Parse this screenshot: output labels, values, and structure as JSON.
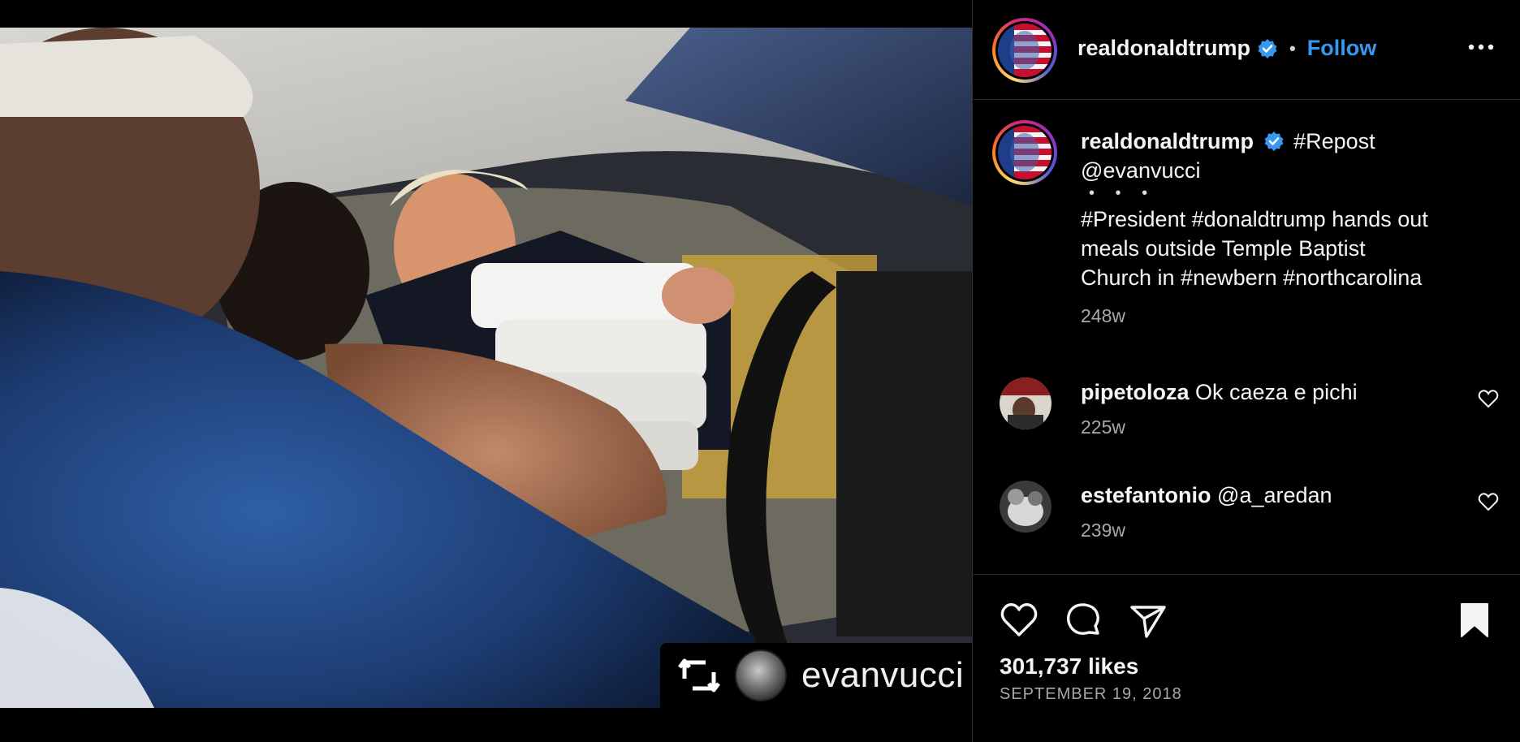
{
  "post": {
    "repost_credit": {
      "username": "evanvucci",
      "icon": "repost-icon"
    },
    "header": {
      "username": "realdonaldtrump",
      "separator": "•",
      "follow_label": "Follow",
      "verified_icon": "verified-badge-icon",
      "more_icon": "more-options-icon"
    },
    "caption": {
      "username": "realdonaldtrump",
      "line1_rest": "#Repost",
      "line2": "@evanvucci",
      "dots": "• • •",
      "line3": "#President #donaldtrump hands out",
      "line4": "meals outside Temple Baptist",
      "line5": "Church in #newbern #northcarolina",
      "time": "248w"
    },
    "comments": [
      {
        "username": "pipetoloza",
        "text": "Ok caeza e pichi",
        "time": "225w"
      },
      {
        "username": "estefantonio",
        "text": "@a_aredan",
        "time": "239w"
      }
    ],
    "actions": {
      "like_icon": "heart-icon",
      "comment_icon": "comment-icon",
      "share_icon": "send-icon",
      "save_icon": "bookmark-icon",
      "likes": "301,737 likes",
      "date": "SEPTEMBER 19, 2018"
    },
    "colors": {
      "accent": "#3897f0",
      "background": "#000000",
      "muted": "#a8a8a8"
    }
  }
}
